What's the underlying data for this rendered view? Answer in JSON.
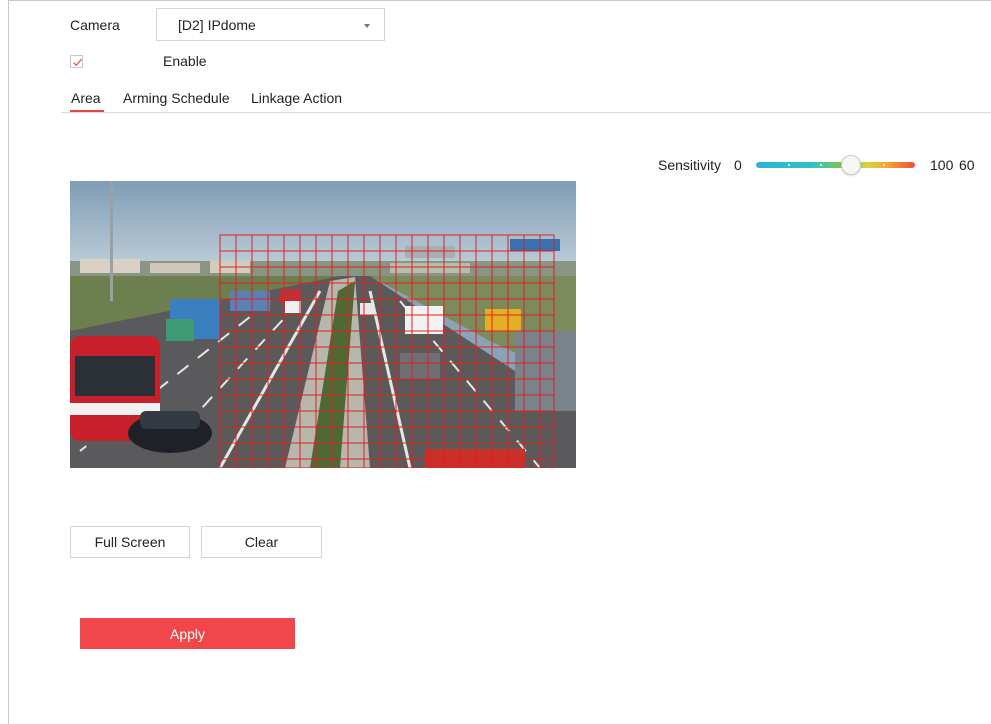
{
  "camera": {
    "label": "Camera",
    "selected": "[D2] IPdome"
  },
  "enable": {
    "label": "Enable",
    "checked": true
  },
  "tabs": [
    {
      "label": "Area",
      "active": true
    },
    {
      "label": "Arming Schedule",
      "active": false
    },
    {
      "label": "Linkage Action",
      "active": false
    }
  ],
  "sensitivity": {
    "label": "Sensitivity",
    "min_label": "0",
    "max_label": "100",
    "value_label": "60",
    "value": 60,
    "min": 0,
    "max": 100
  },
  "buttons": {
    "full_screen": "Full Screen",
    "clear": "Clear",
    "apply": "Apply"
  },
  "colors": {
    "accent": "#f2474a",
    "grid": "#e02020"
  }
}
